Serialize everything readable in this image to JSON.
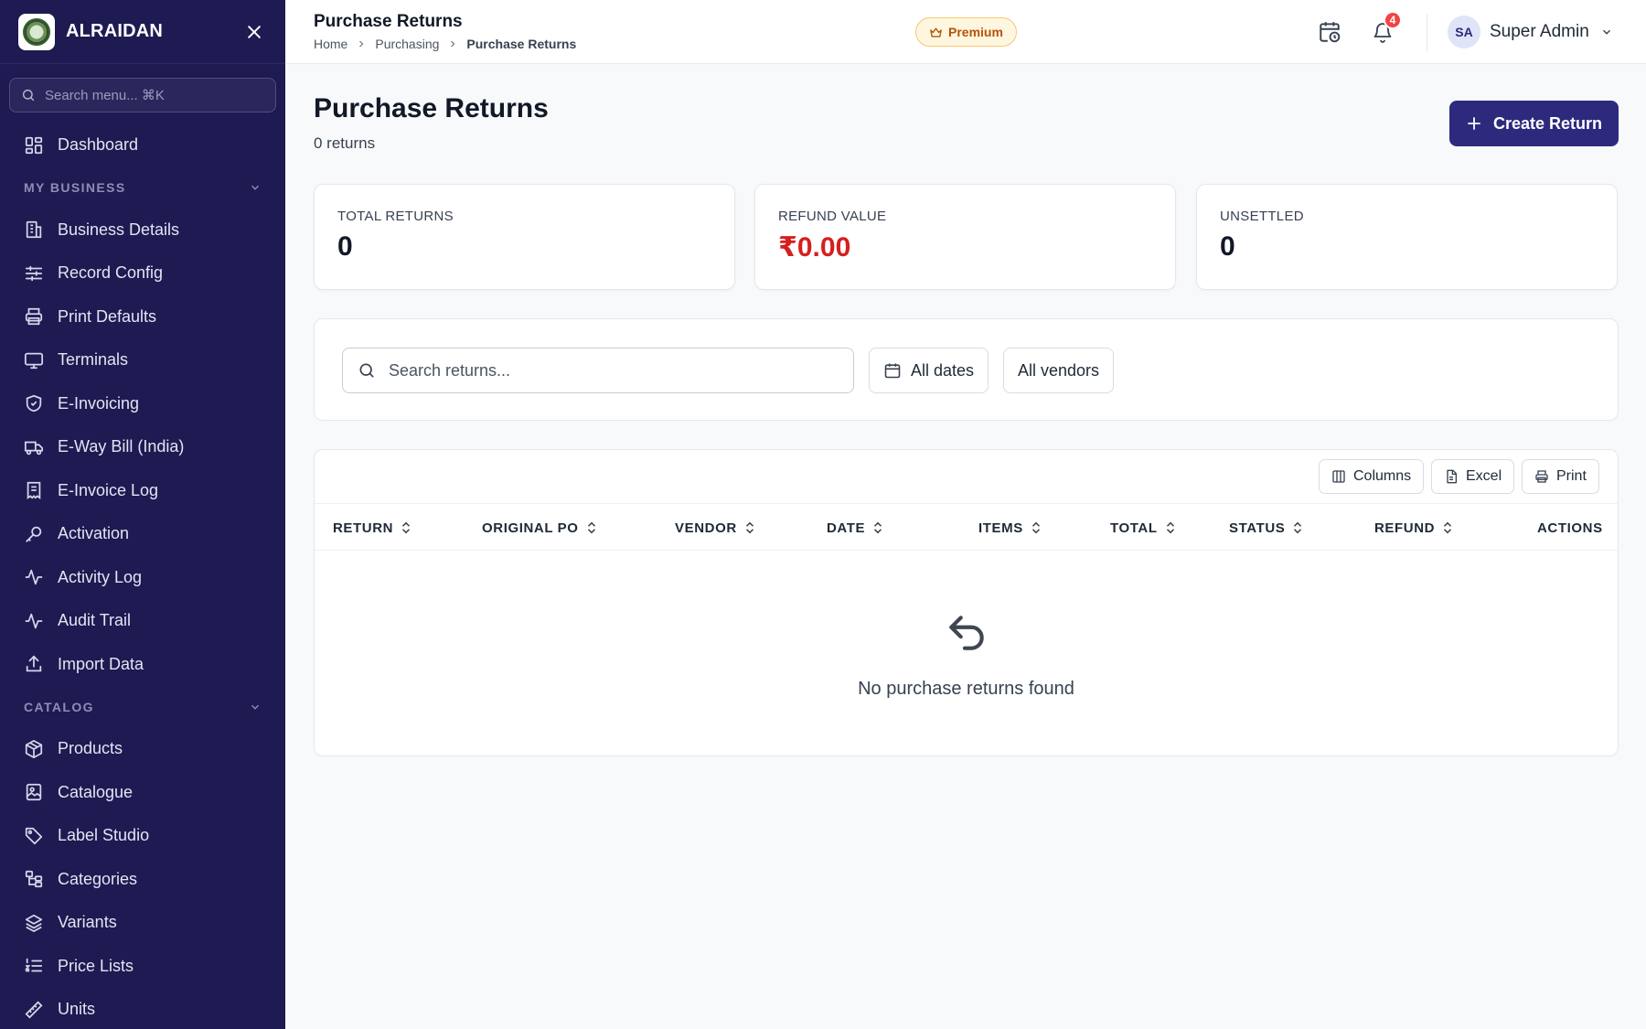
{
  "brand": {
    "name": "ALRAIDAN"
  },
  "sidebar": {
    "search_placeholder": "Search menu... ⌘K",
    "dashboard": "Dashboard",
    "sections": [
      {
        "title": "MY BUSINESS",
        "items": [
          {
            "label": "Business Details",
            "icon": "building-icon"
          },
          {
            "label": "Record Config",
            "icon": "sliders-icon"
          },
          {
            "label": "Print Defaults",
            "icon": "printer-icon"
          },
          {
            "label": "Terminals",
            "icon": "monitor-icon"
          },
          {
            "label": "E-Invoicing",
            "icon": "shield-check-icon"
          },
          {
            "label": "E-Way Bill (India)",
            "icon": "truck-icon"
          },
          {
            "label": "E-Invoice Log",
            "icon": "receipt-icon"
          },
          {
            "label": "Activation",
            "icon": "key-icon"
          },
          {
            "label": "Activity Log",
            "icon": "activity-icon"
          },
          {
            "label": "Audit Trail",
            "icon": "activity-icon"
          },
          {
            "label": "Import Data",
            "icon": "upload-icon"
          }
        ]
      },
      {
        "title": "CATALOG",
        "items": [
          {
            "label": "Products",
            "icon": "package-icon"
          },
          {
            "label": "Catalogue",
            "icon": "image-icon"
          },
          {
            "label": "Label Studio",
            "icon": "tag-icon"
          },
          {
            "label": "Categories",
            "icon": "folder-tree-icon"
          },
          {
            "label": "Variants",
            "icon": "layers-icon"
          },
          {
            "label": "Price Lists",
            "icon": "list-ordered-icon"
          },
          {
            "label": "Units",
            "icon": "ruler-icon"
          }
        ]
      }
    ]
  },
  "topbar": {
    "title": "Purchase Returns",
    "breadcrumb": [
      "Home",
      "Purchasing",
      "Purchase Returns"
    ],
    "premium": "Premium",
    "notification_count": "4",
    "user_initials": "SA",
    "user_name": "Super Admin"
  },
  "page": {
    "title": "Purchase Returns",
    "subtitle": "0 returns",
    "create_button": "Create Return"
  },
  "stats": [
    {
      "label": "TOTAL RETURNS",
      "value": "0",
      "color": "#111827"
    },
    {
      "label": "REFUND VALUE",
      "value": "₹0.00",
      "color": "#d61f1f"
    },
    {
      "label": "UNSETTLED",
      "value": "0",
      "color": "#111827"
    }
  ],
  "filters": {
    "search_placeholder": "Search returns...",
    "dates": "All dates",
    "vendors": "All vendors"
  },
  "table": {
    "toolbar": {
      "columns": "Columns",
      "excel": "Excel",
      "print": "Print"
    },
    "headers": [
      "RETURN",
      "ORIGINAL PO",
      "VENDOR",
      "DATE",
      "ITEMS",
      "TOTAL",
      "STATUS",
      "REFUND",
      "ACTIONS"
    ],
    "empty_message": "No purchase returns found"
  },
  "colors": {
    "sidebar": "#1e1a52",
    "primary": "#2d2a7e",
    "accent_red": "#d61f1f",
    "premium": "#b45309"
  }
}
